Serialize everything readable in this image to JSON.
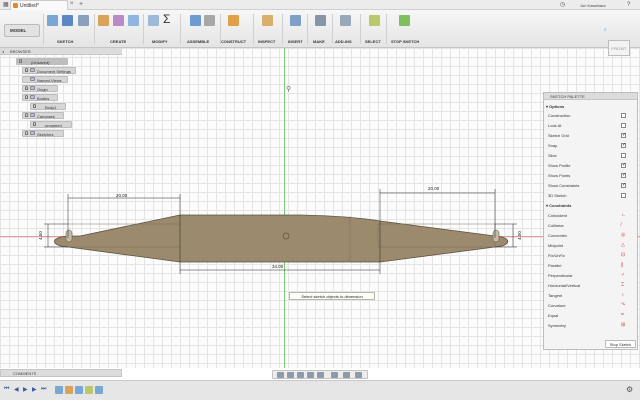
{
  "titlebar": {
    "tab_title": "Untitled*",
    "user_name": "Jon Kawahara"
  },
  "toolbar": {
    "mode_label": "MODEL",
    "groups": [
      "SKETCH",
      "CREATE",
      "MODIFY",
      "ASSEMBLE",
      "CONSTRUCT",
      "INSPECT",
      "INSERT",
      "MAKE",
      "ADD-INS",
      "SELECT",
      "STOP SKETCH"
    ]
  },
  "browser": {
    "title": "BROWSER",
    "items": [
      {
        "label": "(Unsaved)"
      },
      {
        "label": "Document Settings"
      },
      {
        "label": "Named Views"
      },
      {
        "label": "Origin"
      },
      {
        "label": "Bodies"
      },
      {
        "label": "Body1"
      },
      {
        "label": "Canvases"
      },
      {
        "label": "unnamed"
      },
      {
        "label": "Sketches"
      }
    ]
  },
  "viewcube": {
    "face_label": "FRONT",
    "axis_label": "Z"
  },
  "palette": {
    "title": "SKETCH PALETTE",
    "options_header": "Options",
    "options": [
      {
        "label": "Construction",
        "checked": false
      },
      {
        "label": "Look At",
        "checked": false
      },
      {
        "label": "Sketch Grid",
        "checked": true
      },
      {
        "label": "Snap",
        "checked": true
      },
      {
        "label": "Slice",
        "checked": false
      },
      {
        "label": "Show Profile",
        "checked": true
      },
      {
        "label": "Show Points",
        "checked": true
      },
      {
        "label": "Show Constraints",
        "checked": true
      },
      {
        "label": "3D Sketch",
        "checked": false
      }
    ],
    "constraints_header": "Constraints",
    "constraints": [
      {
        "label": "Coincident",
        "icon": "coincident-icon",
        "glyph": "∟"
      },
      {
        "label": "Collinear",
        "icon": "collinear-icon",
        "glyph": "⁄"
      },
      {
        "label": "Concentric",
        "icon": "concentric-icon",
        "glyph": "◎"
      },
      {
        "label": "Midpoint",
        "icon": "midpoint-icon",
        "glyph": "△"
      },
      {
        "label": "Fix/UnFix",
        "icon": "lock-icon",
        "glyph": "⊡"
      },
      {
        "label": "Parallel",
        "icon": "parallel-icon",
        "glyph": "∥"
      },
      {
        "label": "Perpendicular",
        "icon": "perpendicular-icon",
        "glyph": "✓"
      },
      {
        "label": "Horizontal/Vertical",
        "icon": "horizontal-vertical-icon",
        "glyph": "⌶"
      },
      {
        "label": "Tangent",
        "icon": "tangent-icon",
        "glyph": "♁"
      },
      {
        "label": "Curvature",
        "icon": "curvature-icon",
        "glyph": "↷"
      },
      {
        "label": "Equal",
        "icon": "equal-icon",
        "glyph": "="
      },
      {
        "label": "Symmetry",
        "icon": "symmetry-icon",
        "glyph": "⊞"
      }
    ],
    "stop_label": "Stop Sketch"
  },
  "dimensions": {
    "left_width": "20.00",
    "right_width": "20.00",
    "middle_width": "34.00",
    "left_height": "4.50",
    "right_height": "4.50"
  },
  "tooltip": "Select sketch objects to dimension",
  "comments_label": "COMMENTS"
}
